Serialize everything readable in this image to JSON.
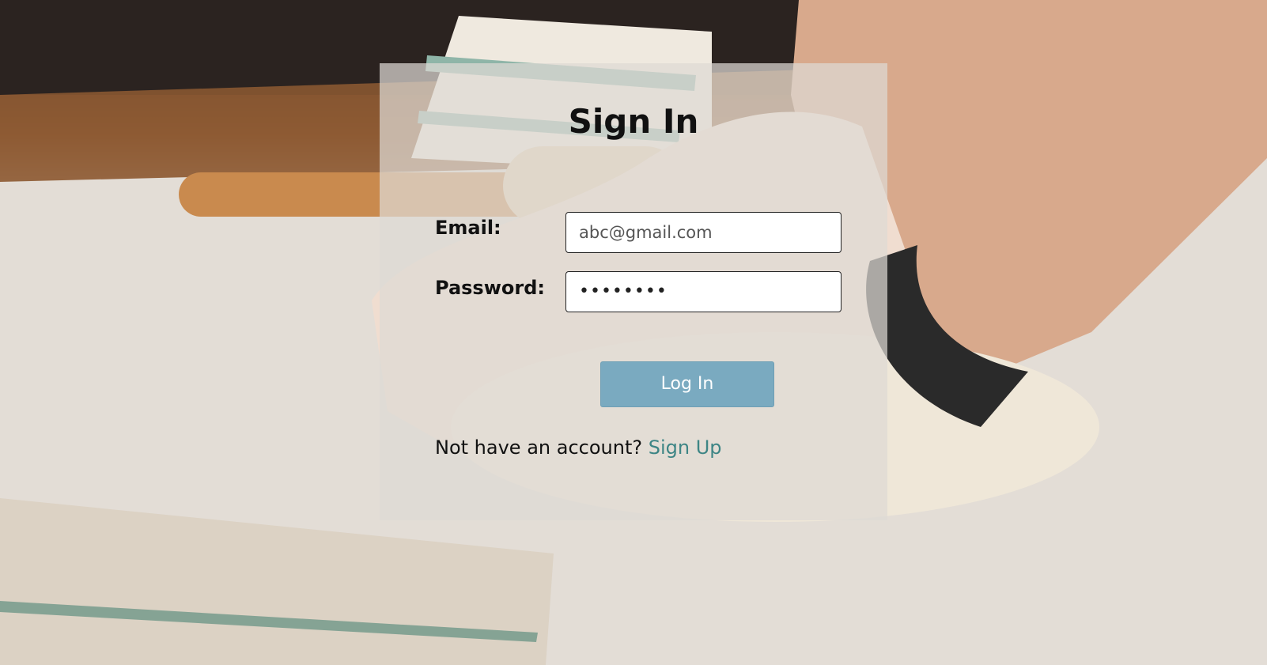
{
  "form": {
    "title": "Sign In",
    "email_label": "Email:",
    "email_value": "abc@gmail.com",
    "password_label": "Password:",
    "password_value": "••••••••",
    "login_button": "Log In",
    "signup_prompt": "Not have an account?",
    "signup_link": "Sign Up"
  },
  "colors": {
    "button": "#7aaac0",
    "link": "#3d8585"
  }
}
